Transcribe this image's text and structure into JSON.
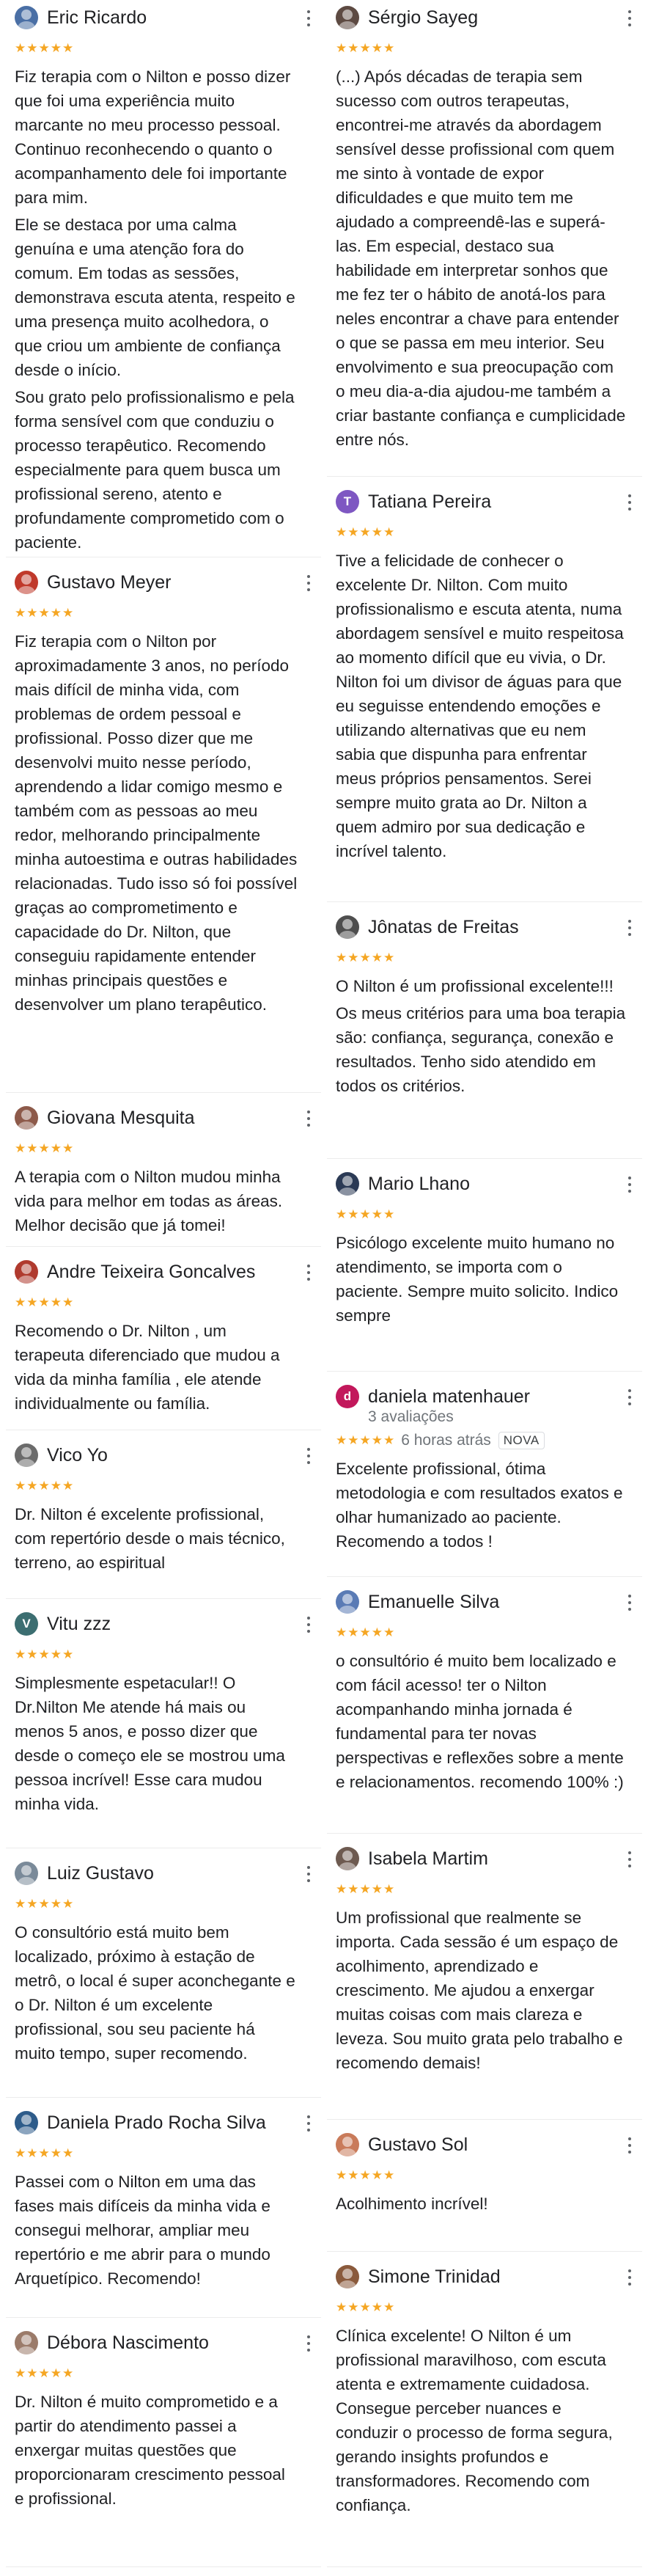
{
  "colors": {
    "star": "#f5a623",
    "muted": "#70757a",
    "text": "#202124"
  },
  "icons": {
    "more": "more-vert-icon",
    "star": "star-icon"
  },
  "reviews_left": [
    {
      "name": "Eric Ricardo",
      "stars": "★★★★★",
      "avatar_color": "#4a6fa5",
      "paragraphs": [
        "Fiz terapia com o Nilton e posso dizer que foi uma experiência muito marcante no meu processo pessoal. Continuo reconhecendo o quanto o acompanhamento dele foi importante para mim.",
        "Ele se destaca por uma calma genuína e uma atenção fora do comum. Em todas as sessões, demonstrava escuta atenta, respeito e uma presença muito acolhedora, o que criou um ambiente de confiança desde o início.",
        "Sou grato pelo profissionalismo e pela forma sensível com que conduziu o processo terapêutico. Recomendo especialmente para quem busca um profissional sereno, atento e profundamente comprometido com o paciente."
      ]
    },
    {
      "name": "Gustavo Meyer",
      "stars": "★★★★★",
      "avatar_color": "#c0392b",
      "paragraphs": [
        "Fiz terapia com o Nilton por aproximadamente 3 anos, no período mais difícil de minha vida, com problemas de ordem pessoal e profissional. Posso dizer que me desenvolvi muito nesse período, aprendendo a lidar comigo mesmo e também com as pessoas ao meu redor, melhorando principalmente minha autoestima e outras habilidades relacionadas. Tudo isso só foi possível graças ao comprometimento e capacidade do Dr. Nilton, que conseguiu rapidamente entender minhas principais questões e desenvolver um plano terapêutico."
      ]
    },
    {
      "name": "Giovana Mesquita",
      "stars": "★★★★★",
      "avatar_color": "#8d5a4a",
      "paragraphs": [
        "A terapia com o Nilton mudou minha vida para melhor em todas as áreas. Melhor decisão que já tomei!"
      ]
    },
    {
      "name": "Andre Teixeira Goncalves",
      "stars": "★★★★★",
      "avatar_color": "#b03a2e",
      "paragraphs": [
        "Recomendo o Dr. Nilton , um terapeuta diferenciado que mudou a vida da minha família , ele atende individualmente ou família."
      ]
    },
    {
      "name": "Vico Yo",
      "stars": "★★★★★",
      "avatar_color": "#6b6b6b",
      "paragraphs": [
        "Dr. Nilton é excelente profissional, com repertório desde o mais técnico, terreno, ao espiritual"
      ]
    },
    {
      "name": "Vitu zzz",
      "stars": "★★★★★",
      "avatar_color": "#3c6e71",
      "initial": "V",
      "paragraphs": [
        "Simplesmente espetacular!! O Dr.Nilton Me atende há mais ou menos 5 anos, e posso dizer que desde o começo ele se mostrou uma pessoa incrível! Esse cara mudou minha vida."
      ]
    },
    {
      "name": "Luiz Gustavo",
      "stars": "★★★★★",
      "avatar_color": "#7a8a99",
      "paragraphs": [
        "O consultório está muito bem localizado, próximo à estação de metrô, o local é super aconchegante e o Dr. Nilton é um excelente profissional, sou seu paciente há muito tempo, super recomendo."
      ]
    },
    {
      "name": "Daniela Prado Rocha Silva",
      "stars": "★★★★★",
      "avatar_color": "#2e5c8a",
      "paragraphs": [
        "Passei com o Nilton em uma das fases mais difíceis da minha vida e consegui melhorar, ampliar meu repertório e me abrir para o mundo Arquetípico. Recomendo!"
      ]
    },
    {
      "name": "Débora Nascimento",
      "stars": "★★★★★",
      "avatar_color": "#9b7b6a",
      "paragraphs": [
        "Dr. Nilton é muito comprometido e a partir do atendimento passei a enxergar muitas questões que proporcionaram crescimento pessoal e profissional."
      ]
    }
  ],
  "reviews_right": [
    {
      "name": "Sérgio Sayeg",
      "stars": "★★★★★",
      "avatar_color": "#5d4a42",
      "paragraphs": [
        "(...) Após décadas de terapia sem sucesso com outros terapeutas, encontrei-me através da abordagem sensível desse profissional com quem me sinto à vontade de expor dificuldades e que muito tem me ajudado a compreendê-las e superá-las. Em especial, destaco sua habilidade em interpretar sonhos que me fez ter o hábito de anotá-los para neles encontrar a chave para entender o que se passa em meu interior. Seu envolvimento e sua preocupação com o meu dia-a-dia ajudou-me também a criar bastante confiança e cumplicidade entre nós."
      ]
    },
    {
      "name": "Tatiana Pereira",
      "stars": "★★★★★",
      "avatar_color": "#7e57c2",
      "initial": "T",
      "paragraphs": [
        "Tive a felicidade de conhecer o excelente Dr. Nilton. Com muito profissionalismo e escuta atenta, numa abordagem sensível e muito respeitosa ao momento difícil que eu vivia, o Dr. Nilton foi um divisor de águas para que eu seguisse entendendo emoções e utilizando alternativas que eu nem sabia que dispunha para enfrentar meus próprios pensamentos. Serei sempre muito grata ao Dr. Nilton a quem admiro por sua dedicação e incrível talento."
      ]
    },
    {
      "name": "Jônatas de Freitas",
      "stars": "★★★★★",
      "avatar_color": "#4e4e4e",
      "paragraphs": [
        "O Nilton é um profissional excelente!!!",
        "Os meus critérios para uma boa terapia são: confiança, segurança, conexão e resultados. Tenho sido atendido em todos os critérios."
      ]
    },
    {
      "name": "Mario Lhano",
      "stars": "★★★★★",
      "avatar_color": "#2b3a55",
      "paragraphs": [
        "Psicólogo excelente muito humano no atendimento, se importa com o paciente. Sempre muito solicito. Indico sempre"
      ]
    },
    {
      "name": "daniela matenhauer",
      "stars": "★★★★★",
      "avatar_color": "#c2185b",
      "initial": "d",
      "sub": "3 avaliações",
      "when": "6 horas atrás",
      "badge": "NOVA",
      "paragraphs": [
        "Excelente profissional, ótima metodologia e com resultados exatos e olhar humanizado ao paciente. Recomendo a todos !"
      ]
    },
    {
      "name": "Emanuelle Silva",
      "stars": "★★★★★",
      "avatar_color": "#5a7bb5",
      "paragraphs": [
        "o consultório é muito bem localizado e com fácil acesso! ter o Nilton acompanhando minha jornada é fundamental para ter novas perspectivas e reflexões sobre a mente e relacionamentos. recomendo 100% :)"
      ]
    },
    {
      "name": "Isabela Martim",
      "stars": "★★★★★",
      "avatar_color": "#6d5a50",
      "paragraphs": [
        "Um profissional que realmente se importa. Cada sessão é um espaço de acolhimento, aprendizado e crescimento. Me ajudou a enxergar muitas coisas com mais clareza e leveza. Sou muito grata pelo trabalho e recomendo demais!"
      ]
    },
    {
      "name": "Gustavo Sol",
      "stars": "★★★★★",
      "avatar_color": "#c97b5a",
      "paragraphs": [
        "Acolhimento incrível!"
      ]
    },
    {
      "name": "Simone Trinidad",
      "stars": "★★★★★",
      "avatar_color": "#8a5a3c",
      "paragraphs": [
        "Clínica excelente! O Nilton é um profissional maravilhoso, com escuta atenta e extremamente cuidadosa. Consegue perceber nuances e conduzir o processo de forma segura, gerando insights profundos e transformadores. Recomendo com confiança."
      ]
    }
  ]
}
